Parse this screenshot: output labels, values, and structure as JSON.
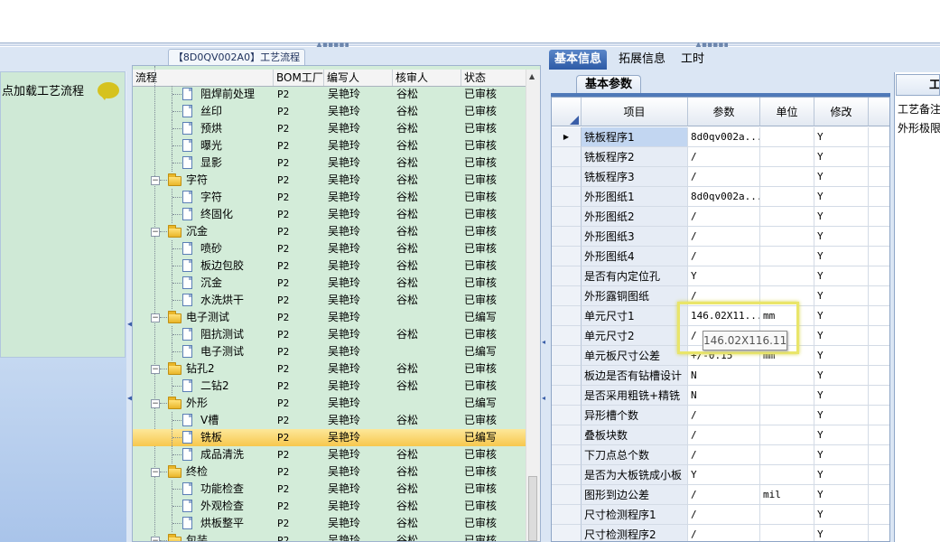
{
  "left_panel": {
    "label": "点加载工艺流程"
  },
  "tree": {
    "title": "【8D0QV002A0】工艺流程",
    "columns": [
      "流程",
      "BOM工厂",
      "编写人",
      "核审人",
      "状态"
    ],
    "rows": [
      {
        "name": "阻焊前处理",
        "type": "doc",
        "level": 2,
        "plant": "P2",
        "writer": "吴艳玲",
        "checker": "谷松",
        "status": "已审核"
      },
      {
        "name": "丝印",
        "type": "doc",
        "level": 2,
        "plant": "P2",
        "writer": "吴艳玲",
        "checker": "谷松",
        "status": "已审核"
      },
      {
        "name": "预烘",
        "type": "doc",
        "level": 2,
        "plant": "P2",
        "writer": "吴艳玲",
        "checker": "谷松",
        "status": "已审核"
      },
      {
        "name": "曝光",
        "type": "doc",
        "level": 2,
        "plant": "P2",
        "writer": "吴艳玲",
        "checker": "谷松",
        "status": "已审核"
      },
      {
        "name": "显影",
        "type": "doc",
        "level": 2,
        "plant": "P2",
        "writer": "吴艳玲",
        "checker": "谷松",
        "status": "已审核"
      },
      {
        "name": "字符",
        "type": "folder",
        "level": 1,
        "plant": "P2",
        "writer": "吴艳玲",
        "checker": "谷松",
        "status": "已审核"
      },
      {
        "name": "字符",
        "type": "doc",
        "level": 2,
        "plant": "P2",
        "writer": "吴艳玲",
        "checker": "谷松",
        "status": "已审核"
      },
      {
        "name": "终固化",
        "type": "doc",
        "level": 2,
        "plant": "P2",
        "writer": "吴艳玲",
        "checker": "谷松",
        "status": "已审核"
      },
      {
        "name": "沉金",
        "type": "folder",
        "level": 1,
        "plant": "P2",
        "writer": "吴艳玲",
        "checker": "谷松",
        "status": "已审核"
      },
      {
        "name": "喷砂",
        "type": "doc",
        "level": 2,
        "plant": "P2",
        "writer": "吴艳玲",
        "checker": "谷松",
        "status": "已审核"
      },
      {
        "name": "板边包胶",
        "type": "doc",
        "level": 2,
        "plant": "P2",
        "writer": "吴艳玲",
        "checker": "谷松",
        "status": "已审核"
      },
      {
        "name": "沉金",
        "type": "doc",
        "level": 2,
        "plant": "P2",
        "writer": "吴艳玲",
        "checker": "谷松",
        "status": "已审核"
      },
      {
        "name": "水洗烘干",
        "type": "doc",
        "level": 2,
        "plant": "P2",
        "writer": "吴艳玲",
        "checker": "谷松",
        "status": "已审核"
      },
      {
        "name": "电子测试",
        "type": "folder",
        "level": 1,
        "plant": "P2",
        "writer": "吴艳玲",
        "checker": "",
        "status": "已编写"
      },
      {
        "name": "阻抗测试",
        "type": "doc",
        "level": 2,
        "plant": "P2",
        "writer": "吴艳玲",
        "checker": "谷松",
        "status": "已审核"
      },
      {
        "name": "电子测试",
        "type": "doc",
        "level": 2,
        "plant": "P2",
        "writer": "吴艳玲",
        "checker": "",
        "status": "已编写"
      },
      {
        "name": "钻孔2",
        "type": "folder",
        "level": 1,
        "plant": "P2",
        "writer": "吴艳玲",
        "checker": "谷松",
        "status": "已审核"
      },
      {
        "name": "二钻2",
        "type": "doc",
        "level": 2,
        "plant": "P2",
        "writer": "吴艳玲",
        "checker": "谷松",
        "status": "已审核"
      },
      {
        "name": "外形",
        "type": "folder",
        "level": 1,
        "plant": "P2",
        "writer": "吴艳玲",
        "checker": "",
        "status": "已编写"
      },
      {
        "name": "V槽",
        "type": "doc",
        "level": 2,
        "plant": "P2",
        "writer": "吴艳玲",
        "checker": "谷松",
        "status": "已审核"
      },
      {
        "name": "铣板",
        "type": "doc",
        "level": 2,
        "plant": "P2",
        "writer": "吴艳玲",
        "checker": "",
        "status": "已编写",
        "selected": true
      },
      {
        "name": "成品清洗",
        "type": "doc",
        "level": 2,
        "plant": "P2",
        "writer": "吴艳玲",
        "checker": "谷松",
        "status": "已审核"
      },
      {
        "name": "终检",
        "type": "folder",
        "level": 1,
        "plant": "P2",
        "writer": "吴艳玲",
        "checker": "谷松",
        "status": "已审核"
      },
      {
        "name": "功能检查",
        "type": "doc",
        "level": 2,
        "plant": "P2",
        "writer": "吴艳玲",
        "checker": "谷松",
        "status": "已审核"
      },
      {
        "name": "外观检查",
        "type": "doc",
        "level": 2,
        "plant": "P2",
        "writer": "吴艳玲",
        "checker": "谷松",
        "status": "已审核"
      },
      {
        "name": "烘板整平",
        "type": "doc",
        "level": 2,
        "plant": "P2",
        "writer": "吴艳玲",
        "checker": "谷松",
        "status": "已审核"
      },
      {
        "name": "包装",
        "type": "folder",
        "level": 1,
        "plant": "P2",
        "writer": "吴艳玲",
        "checker": "谷松",
        "status": "已审核"
      }
    ]
  },
  "right": {
    "tabs": [
      "基本信息",
      "拓展信息",
      "工时"
    ],
    "active_tab": 0,
    "subtab": "基本参数",
    "grid_columns": [
      "项目",
      "参数",
      "单位",
      "修改"
    ],
    "grid_rows": [
      {
        "item": "铣板程序1",
        "param": "8d0qv002a...",
        "unit": "",
        "modify": "Y",
        "current": true
      },
      {
        "item": "铣板程序2",
        "param": "/",
        "unit": "",
        "modify": "Y"
      },
      {
        "item": "铣板程序3",
        "param": "/",
        "unit": "",
        "modify": "Y"
      },
      {
        "item": "外形图纸1",
        "param": "8d0qv002a...",
        "unit": "",
        "modify": "Y"
      },
      {
        "item": "外形图纸2",
        "param": "/",
        "unit": "",
        "modify": "Y"
      },
      {
        "item": "外形图纸3",
        "param": "/",
        "unit": "",
        "modify": "Y"
      },
      {
        "item": "外形图纸4",
        "param": "/",
        "unit": "",
        "modify": "Y"
      },
      {
        "item": "是否有内定位孔",
        "param": "Y",
        "unit": "",
        "modify": "Y"
      },
      {
        "item": "外形露铜图纸",
        "param": "/",
        "unit": "",
        "modify": "Y"
      },
      {
        "item": "单元尺寸1",
        "param": "146.02X11...",
        "unit": "mm",
        "modify": "Y"
      },
      {
        "item": "单元尺寸2",
        "param": "/",
        "unit": "",
        "modify": "Y"
      },
      {
        "item": "单元板尺寸公差",
        "param": "+/-0.15",
        "unit": "mm",
        "modify": "Y"
      },
      {
        "item": "板边是否有钻槽设计",
        "param": "N",
        "unit": "",
        "modify": "Y"
      },
      {
        "item": "是否采用粗铣+精铣",
        "param": "N",
        "unit": "",
        "modify": "Y"
      },
      {
        "item": "异形槽个数",
        "param": "/",
        "unit": "",
        "modify": "Y"
      },
      {
        "item": "叠板块数",
        "param": "/",
        "unit": "",
        "modify": "Y"
      },
      {
        "item": "下刀点总个数",
        "param": "/",
        "unit": "",
        "modify": "Y"
      },
      {
        "item": "是否为大板铣成小板",
        "param": "Y",
        "unit": "",
        "modify": "Y"
      },
      {
        "item": "图形到边公差",
        "param": "/",
        "unit": "mil",
        "modify": "Y"
      },
      {
        "item": "尺寸检测程序1",
        "param": "/",
        "unit": "",
        "modify": "Y"
      },
      {
        "item": "尺寸检测程序2",
        "param": "/",
        "unit": "",
        "modify": "Y"
      }
    ],
    "tooltip": "146.02X116.11",
    "far_right": {
      "header": "工",
      "text1": "工艺备注",
      "text2": "外形极限"
    }
  },
  "colors": {
    "tab_active": "#2d5aa6",
    "tree_bg": "#d3ecd9",
    "selected_row": "#f7c74d",
    "highlight_box": "#e9e56a"
  },
  "icons": {
    "folder": "folder-icon",
    "document": "document-icon",
    "comment": "comment-bubble-icon"
  }
}
